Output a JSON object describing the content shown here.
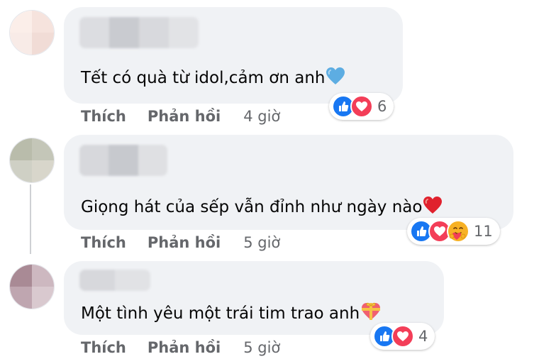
{
  "comments": [
    {
      "text": "Tết có quà từ idol,cảm ơn anh",
      "emoji": "blue-heart-icon",
      "reaction_icons": [
        "like-icon",
        "love-icon"
      ],
      "reaction_count": "6",
      "actions": {
        "like": "Thích",
        "reply": "Phản hồi",
        "time": "4 giờ"
      }
    },
    {
      "text": "Giọng hát của sếp vẫn đỉnh như ngày nào",
      "emoji": "red-heart-icon",
      "reaction_icons": [
        "like-icon",
        "love-icon",
        "care-icon"
      ],
      "reaction_count": "11",
      "actions": {
        "like": "Thích",
        "reply": "Phản hồi",
        "time": "5 giờ"
      }
    },
    {
      "text": "Một tình yêu một trái tim trao anh",
      "emoji": "heart-with-ribbon-icon",
      "reaction_icons": [
        "like-icon",
        "love-icon"
      ],
      "reaction_count": "4",
      "actions": {
        "like": "Thích",
        "reply": "Phản hồi",
        "time": "5 giờ"
      }
    }
  ],
  "colors": {
    "bubble": "#f0f2f5",
    "meta_text": "#65676b",
    "like_blue": "#1877f2",
    "love_red": "#f33e58",
    "care_yellow": "#f7b125"
  }
}
